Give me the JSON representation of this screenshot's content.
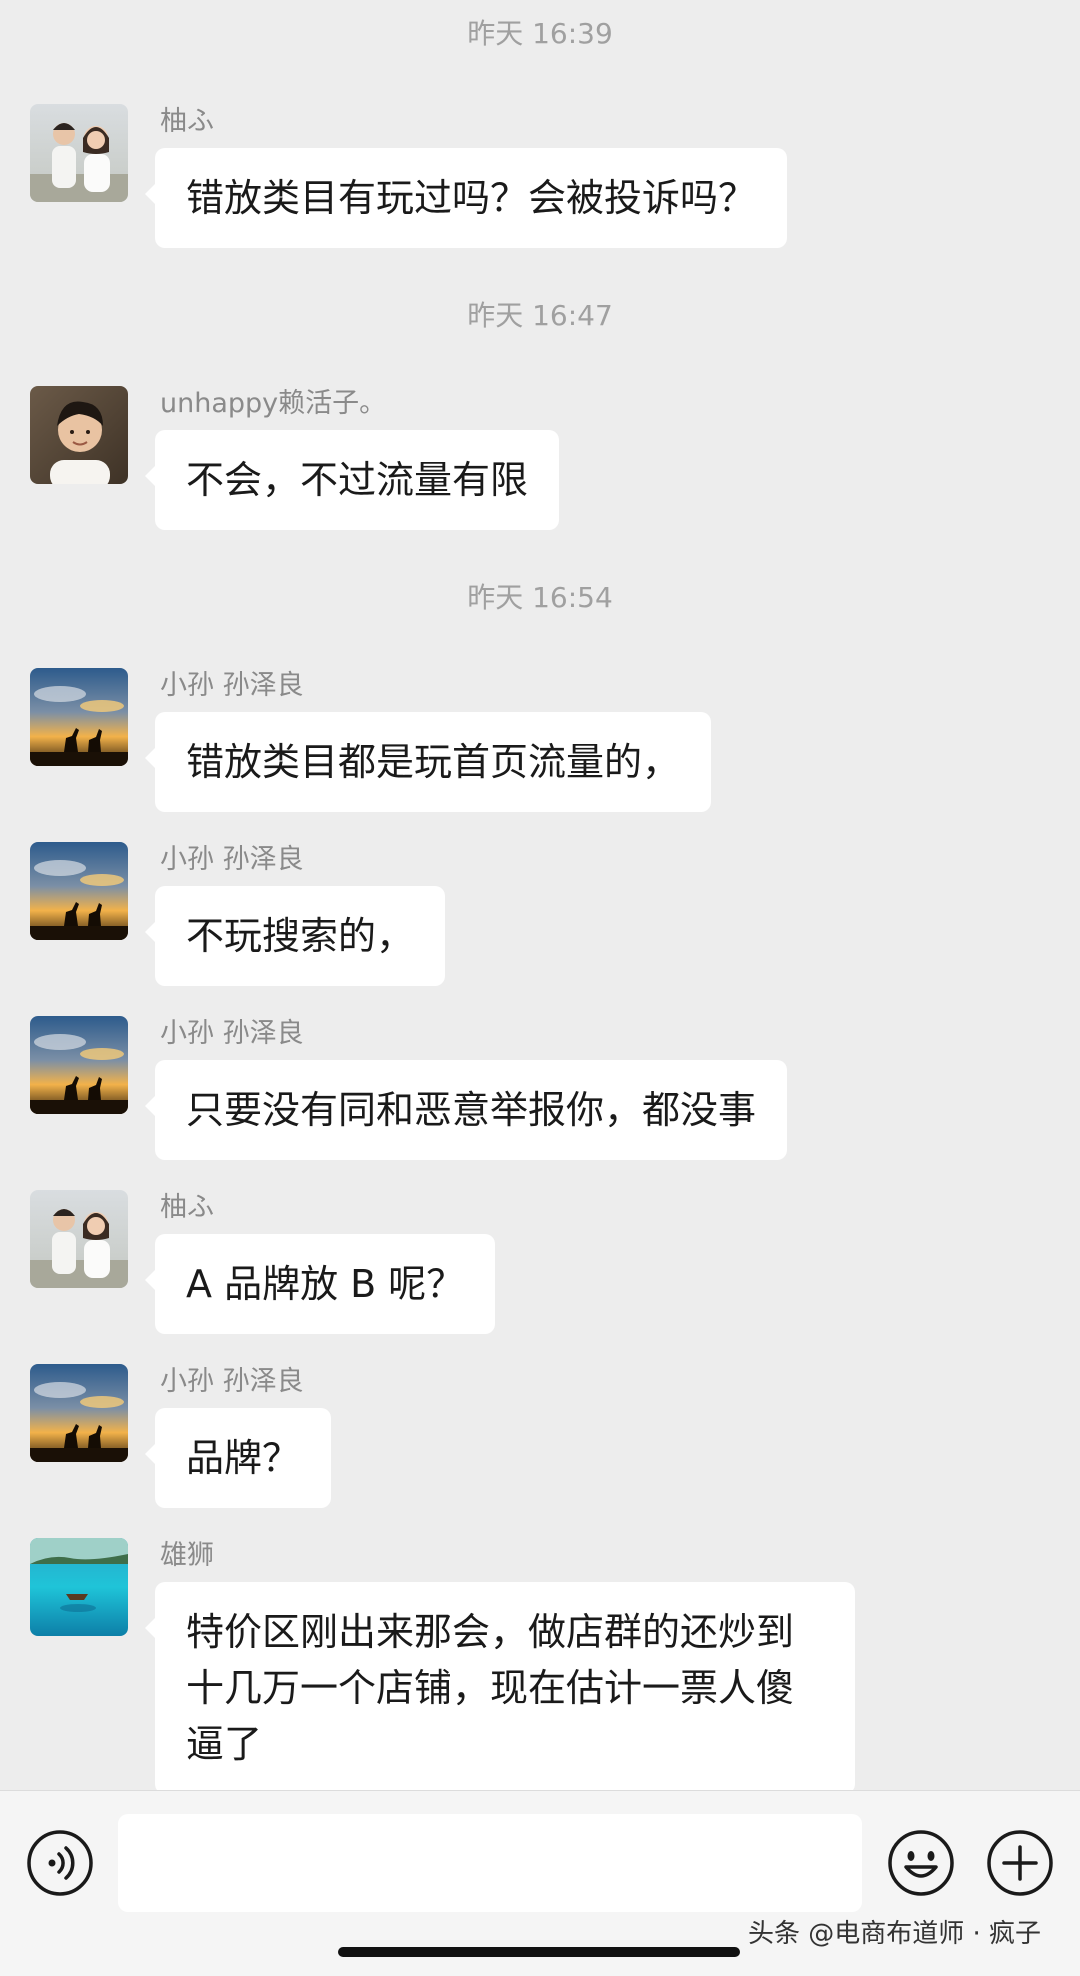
{
  "timestamps": [
    "昨天 16:39",
    "昨天 16:47",
    "昨天 16:54"
  ],
  "messages": [
    {
      "sender": "柚ふ",
      "text": "错放类目有玩过吗？会被投诉吗？",
      "avatar": "couple-photo-avatar"
    },
    {
      "sender": "unhappy赖活子。",
      "text": "不会，不过流量有限",
      "avatar": "man-portrait-avatar"
    },
    {
      "sender": "小孙 孙泽良",
      "text": "错放类目都是玩首页流量的，",
      "avatar": "deer-sunset-avatar"
    },
    {
      "sender": "小孙 孙泽良",
      "text": "不玩搜索的，",
      "avatar": "deer-sunset-avatar"
    },
    {
      "sender": "小孙 孙泽良",
      "text": "只要没有同和恶意举报你，都没事",
      "avatar": "deer-sunset-avatar"
    },
    {
      "sender": "柚ふ",
      "text": "A 品牌放 B 呢？",
      "avatar": "couple-photo-avatar"
    },
    {
      "sender": "小孙 孙泽良",
      "text": "品牌？",
      "avatar": "deer-sunset-avatar"
    },
    {
      "sender": "雄狮",
      "text": "特价区刚出来那会，做店群的还炒到十几万一个店铺，现在估计一票人傻逼了",
      "avatar": "ocean-boat-avatar"
    }
  ],
  "input_bar": {
    "voice_icon": "voice-icon",
    "emoji_icon": "emoji-icon",
    "plus_icon": "plus-icon"
  },
  "watermark": "头条 @电商布道师 · 疯子",
  "colors": {
    "background": "#ededed",
    "bubble": "#ffffff",
    "timestamp": "#a0a0a0",
    "sender": "#8a8a8a"
  }
}
